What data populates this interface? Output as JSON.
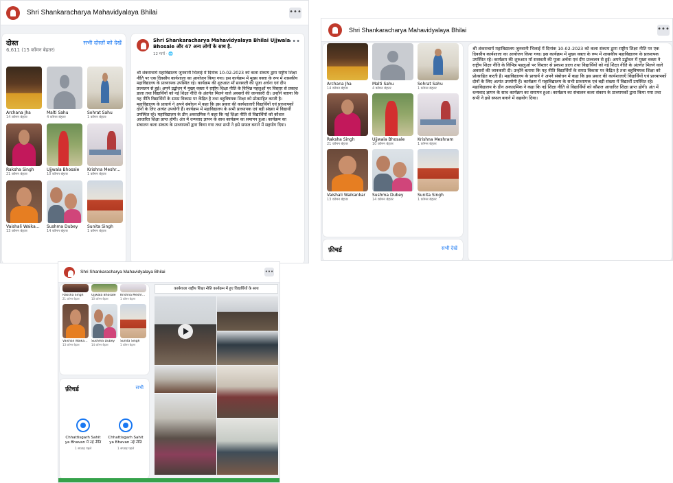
{
  "page": {
    "name": "Shri Shankaracharya Mahavidyalaya Bhilai",
    "name_small": "Shri Shankaracharya Mahavidyalaya Bhilai"
  },
  "menu_icon": "more-horizontal-icon",
  "friends": {
    "title": "दोस्त",
    "count": "6,611 (15 कॉमन बेहतर)",
    "see_all": "सभी दोस्तों को देखें",
    "tiles": [
      {
        "name": "Archana Jha",
        "sub": "14 कॉमन बेहतर"
      },
      {
        "name": "Malti Sahu",
        "sub": "4 कॉमन बेहतर"
      },
      {
        "name": "Sohrat Sahu",
        "sub": "1 कॉमन बेहतर"
      },
      {
        "name": "Raksha Singh",
        "sub": "21 कॉमन बेहतर"
      },
      {
        "name": "Ujjwala Bhosale",
        "sub": "10 कॉमन बेहतर"
      },
      {
        "name": "Krishna Meshram",
        "sub": "1 कॉमन बेहतर"
      },
      {
        "name": "Vaishali Waikankar",
        "sub": "13 कॉमन बेहतर"
      },
      {
        "name": "Sushma Dubey",
        "sub": "14 कॉमन बेहतर"
      },
      {
        "name": "Sunita Singh",
        "sub": "1 कॉमन बेहतर"
      }
    ]
  },
  "post": {
    "author": "Shri Shankaracharya Mahavidyalaya Bhilai Ujjwala Bhosale और 47 अन्य लोगों के साथ है.",
    "meta": "12 मार्च · 🌐",
    "body": "श्री शंकराचार्य महाविद्यालय जुनवानी भिलाई में दिनांक 10-02-2023 को कला संकाय द्वारा राष्ट्रीय शिक्षा नीति पर एक दिवसीय कार्यशाला का आयोजन किया गया। इस कार्यक्रम में मुख्य वक्ता के रूप में शासकीय महाविद्यालय के प्राध्यापक उपस्थित रहे। कार्यक्रम की शुरुआत माँ सरस्वती की पूजा अर्चना एवं दीप प्रज्वलन से हुई। अपने उद्बोधन में मुख्य वक्ता ने राष्ट्रीय शिक्षा नीति के विभिन्न पहलुओं पर विस्तार से प्रकाश डाला तथा विद्यार्थियों को नई शिक्षा नीति के अंतर्गत मिलने वाले अवसरों की जानकारी दी। उन्होंने बताया कि यह नीति विद्यार्थियों के समग्र विकास पर केंद्रित है तथा बहुविषयक शिक्षा को प्रोत्साहित करती है। महाविद्यालय के प्राचार्य ने अपने संबोधन में कहा कि इस प्रकार की कार्यशालाएँ विद्यार्थियों एवं प्राध्यापकों दोनों के लिए अत्यंत उपयोगी हैं। कार्यक्रम में महाविद्यालय के सभी प्राध्यापक एवं बड़ी संख्या में विद्यार्थी उपस्थित रहे। महाविद्यालय के डीन अकादमिक ने कहा कि नई शिक्षा नीति से विद्यार्थियों को कौशल आधारित शिक्षा प्राप्त होगी। अंत में धन्यवाद ज्ञापन के साथ कार्यक्रम का समापन हुआ। कार्यक्रम का संचालन कला संकाय के प्राध्यापकों द्वारा किया गया तथा सभी ने इसे सफल बनाने में सहयोग दिया।"
  },
  "highlights": {
    "title": "फ़ीचर्ड",
    "see_all": "सभी देखें",
    "title_small": "फ़ीचर्ड",
    "see_all_small": "सभी",
    "items": [
      {
        "label": "Chhattisgarh Sahit ya Bhavan में नई नीति",
        "date": "1 सप्ताह पहले"
      },
      {
        "label": "Chhattisgarh Sahit ya Bhavan नई नीति",
        "date": "1 सप्ताह पहले"
      }
    ]
  },
  "video_caption": "कार्यशाला राष्ट्रीय शिक्षा नीति कार्यक्रम में हुए विद्यार्थियों के साथ",
  "colors": {
    "accent": "#1877f2",
    "logo": "#c0392b",
    "green": "#35a24a"
  }
}
